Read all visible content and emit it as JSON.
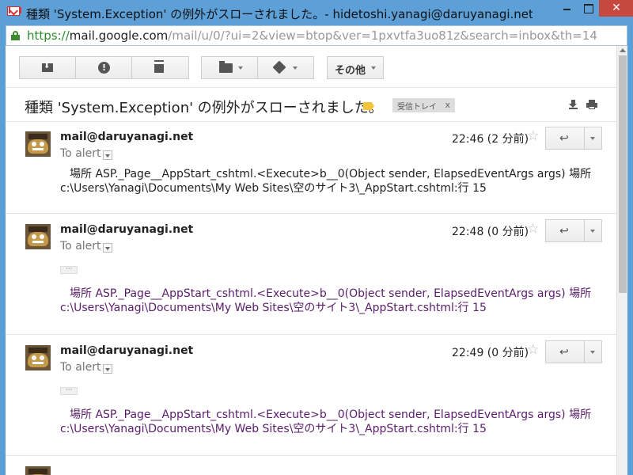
{
  "window": {
    "title": "種類 'System.Exception' の例外がスローされました。- hidetoshi.yanagi@daruyanagi.net - daru…",
    "close_glyph": "✕"
  },
  "address": {
    "protocol": "https://",
    "host": "mail.google.com",
    "path": "/mail/u/0/?ui=2&view=btop&ver=1pxvtfa3uo81z&search=inbox&th=14"
  },
  "toolbar": {
    "more_label": "その他"
  },
  "thread": {
    "subject": "種類 'System.Exception' の例外がスローされました。",
    "label_chip": "受信トレイ",
    "label_chip_close": "x"
  },
  "icons": {
    "archive": "archive-icon",
    "spam": "report-spam-icon",
    "trash": "trash-icon",
    "folder": "move-to-folder-icon",
    "label": "label-icon",
    "star": "☆",
    "reply": "↩"
  },
  "messages": [
    {
      "sender": "mail@daruyanagi.net",
      "to": "To alert",
      "time": "22:46 (2 分前)",
      "body_line1": "場所 ASP._Page__AppStart_cshtml.<Execute>b__0(Object sender, ElapsedEventArgs args) 場所",
      "body_line2": "c:\\Users\\Yanagi\\Documents\\My Web Sites\\空のサイト3\\_AppStart.cshtml:行 15",
      "ellipsis": ""
    },
    {
      "sender": "mail@daruyanagi.net",
      "to": "To alert",
      "time": "22:48 (0 分前)",
      "body_line1": "場所 ASP._Page__AppStart_cshtml.<Execute>b__0(Object sender, ElapsedEventArgs args) 場所",
      "body_line2": "c:\\Users\\Yanagi\\Documents\\My Web Sites\\空のサイト3\\_AppStart.cshtml:行 15",
      "ellipsis": "···"
    },
    {
      "sender": "mail@daruyanagi.net",
      "to": "To alert",
      "time": "22:49 (0 分前)",
      "body_line1": "場所 ASP._Page__AppStart_cshtml.<Execute>b__0(Object sender, ElapsedEventArgs args) 場所",
      "body_line2": "c:\\Users\\Yanagi\\Documents\\My Web Sites\\空のサイト3\\_AppStart.cshtml:行 15",
      "ellipsis": "···"
    }
  ]
}
